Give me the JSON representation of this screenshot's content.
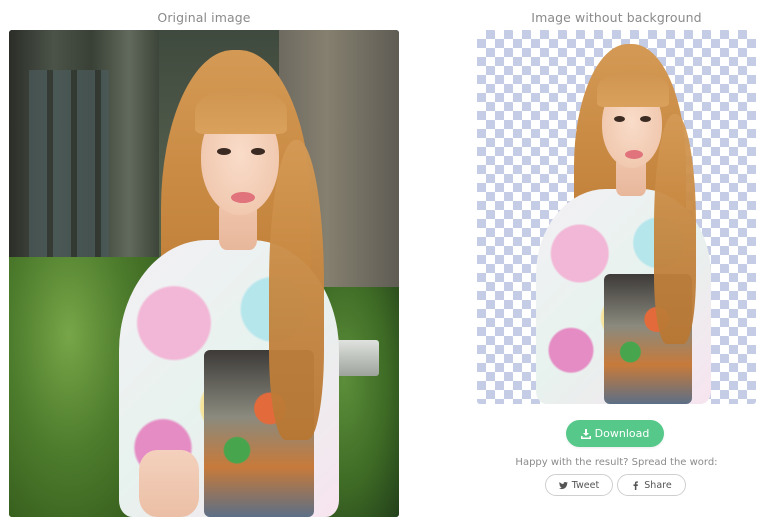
{
  "original": {
    "title": "Original image"
  },
  "result": {
    "title": "Image without background"
  },
  "actions": {
    "download_label": "Download",
    "spread_text": "Happy with the result? Spread the word:",
    "tweet_label": "Tweet",
    "share_label": "Share"
  },
  "icons": {
    "download": "download-icon",
    "twitter": "twitter-icon",
    "facebook": "facebook-icon"
  },
  "colors": {
    "accent": "#55c88a",
    "checker": "#c5cde6",
    "muted_text": "#8a8a8a"
  }
}
